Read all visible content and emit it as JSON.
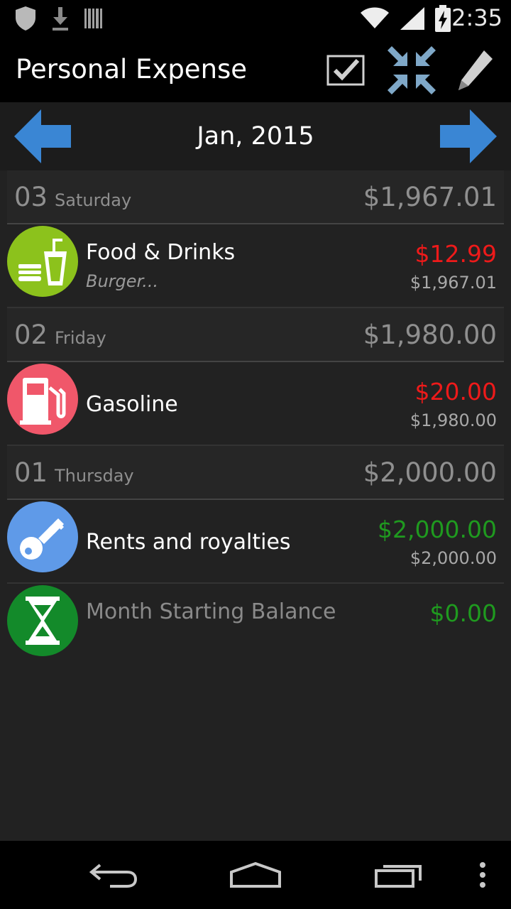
{
  "status_bar": {
    "time": "2:35",
    "icons": [
      "shield-icon",
      "download-icon",
      "barcode-icon",
      "wifi-icon",
      "signal-icon",
      "battery-charging-icon"
    ]
  },
  "action_bar": {
    "title": "Personal Expense",
    "actions": [
      "checkbox-icon",
      "collapse-icon",
      "pencil-icon"
    ]
  },
  "month_nav": {
    "label": "Jan, 2015",
    "prev_icon": "arrow-left-icon",
    "next_icon": "arrow-right-icon"
  },
  "days": [
    {
      "day": "03",
      "weekday": "Saturday",
      "total": "$1,967.01",
      "entries": [
        {
          "category": "Food & Drinks",
          "note": "Burger...",
          "amount": "$12.99",
          "balance": "$1,967.01",
          "type": "expense",
          "icon": "food-drinks-icon",
          "icon_color": "#8cc21c"
        }
      ]
    },
    {
      "day": "02",
      "weekday": "Friday",
      "total": "$1,980.00",
      "entries": [
        {
          "category": "Gasoline",
          "note": "",
          "amount": "$20.00",
          "balance": "$1,980.00",
          "type": "expense",
          "icon": "gas-pump-icon",
          "icon_color": "#f0576a"
        }
      ]
    },
    {
      "day": "01",
      "weekday": "Thursday",
      "total": "$2,000.00",
      "entries": [
        {
          "category": "Rents and royalties",
          "note": "",
          "amount": "$2,000.00",
          "balance": "$2,000.00",
          "type": "income",
          "icon": "key-icon",
          "icon_color": "#5f9ae8"
        }
      ]
    }
  ],
  "starting_balance": {
    "label": "Month Starting Balance",
    "amount": "$0.00",
    "icon": "hourglass-icon",
    "icon_color": "#138a2a"
  },
  "colors": {
    "expense": "#ee1a1a",
    "income": "#1f9a1f",
    "accent_arrow": "#3a86d4"
  },
  "nav_bar": [
    "back-icon",
    "home-icon",
    "recents-icon",
    "overflow-icon"
  ]
}
